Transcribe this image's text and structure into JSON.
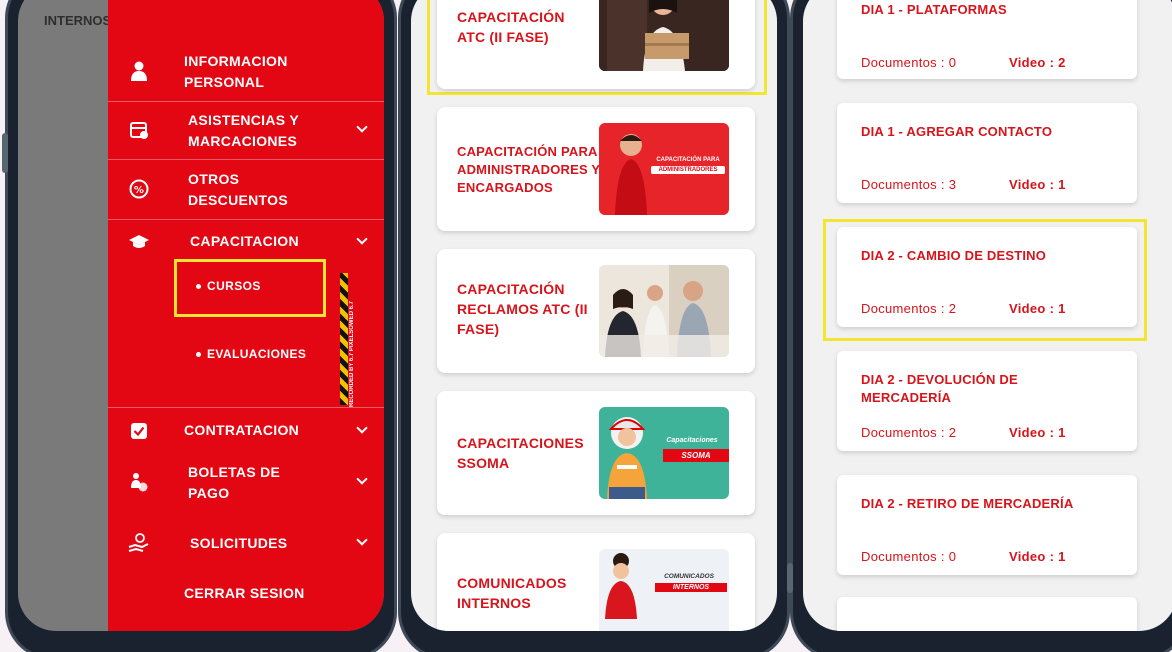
{
  "phone1": {
    "background_text": "INTERNOS",
    "menu": [
      {
        "label_line1": "INFORMACION",
        "label_line2": "PERSONAL",
        "icon": "person-icon"
      },
      {
        "label_line1": "ASISTENCIAS Y",
        "label_line2": "MARCACIONES",
        "icon": "calendar-clock-icon"
      },
      {
        "label_line1": "OTROS",
        "label_line2": "DESCUENTOS",
        "icon": "percent-icon"
      },
      {
        "label": "CAPACITACION",
        "icon": "graduation-cap-icon"
      },
      {
        "label": "CONTRATACION",
        "icon": "checkbox-icon"
      },
      {
        "label_line1": "BOLETAS DE",
        "label_line2": "PAGO",
        "icon": "payroll-icon"
      },
      {
        "label": "SOLICITUDES",
        "icon": "hand-request-icon"
      },
      {
        "label": "CERRAR SESION"
      }
    ],
    "submenu": {
      "cursos": "CURSOS",
      "evaluaciones": "EVALUACIONES"
    },
    "watermark": "RECORDED BY 6.7 PIXELSOWED 6.7"
  },
  "phone2": {
    "cards": [
      {
        "title_lines": [
          "CAPACITACIÓN",
          "ATC (II FASE)"
        ]
      },
      {
        "title_lines": [
          "CAPACITACIÓN PARA",
          "ADMINISTRADORES Y",
          "ENCARGADOS"
        ],
        "thumb_text_1": "CAPACITACIÓN PARA",
        "thumb_text_2": "ADMINISTRADORES"
      },
      {
        "title_lines": [
          "CAPACITACIÓN",
          "RECLAMOS ATC (II",
          "FASE)"
        ]
      },
      {
        "title_lines": [
          "CAPACITACIONES",
          "SSOMA"
        ],
        "thumb_text_1": "Capacitaciones",
        "thumb_text_2": "SSOMA"
      },
      {
        "title_lines": [
          "COMUNICADOS",
          "INTERNOS"
        ],
        "thumb_text_1": "COMUNICADOS",
        "thumb_text_2": "INTERNOS"
      }
    ]
  },
  "phone3": {
    "days": [
      {
        "title_lines": [
          "DIA 1 - PLATAFORMAS"
        ],
        "docs": "Documentos : 0",
        "video": "Video : 2"
      },
      {
        "title_lines": [
          "DIA 1 - AGREGAR CONTACTO"
        ],
        "docs": "Documentos : 3",
        "video": "Video : 1"
      },
      {
        "title_lines": [
          "DIA 2 - CAMBIO DE DESTINO"
        ],
        "docs": "Documentos : 2",
        "video": "Video : 1"
      },
      {
        "title_lines": [
          "DIA 2 - DEVOLUCIÓN DE",
          "MERCADERÍA"
        ],
        "docs": "Documentos : 2",
        "video": "Video : 1"
      },
      {
        "title_lines": [
          "DIA 2 - RETIRO DE MERCADERÍA"
        ],
        "docs": "Documentos : 0",
        "video": "Video : 1"
      }
    ]
  },
  "colors": {
    "brand_red": "#e30613",
    "title_red": "#d7141b",
    "highlight_yellow": "#f3e633"
  }
}
